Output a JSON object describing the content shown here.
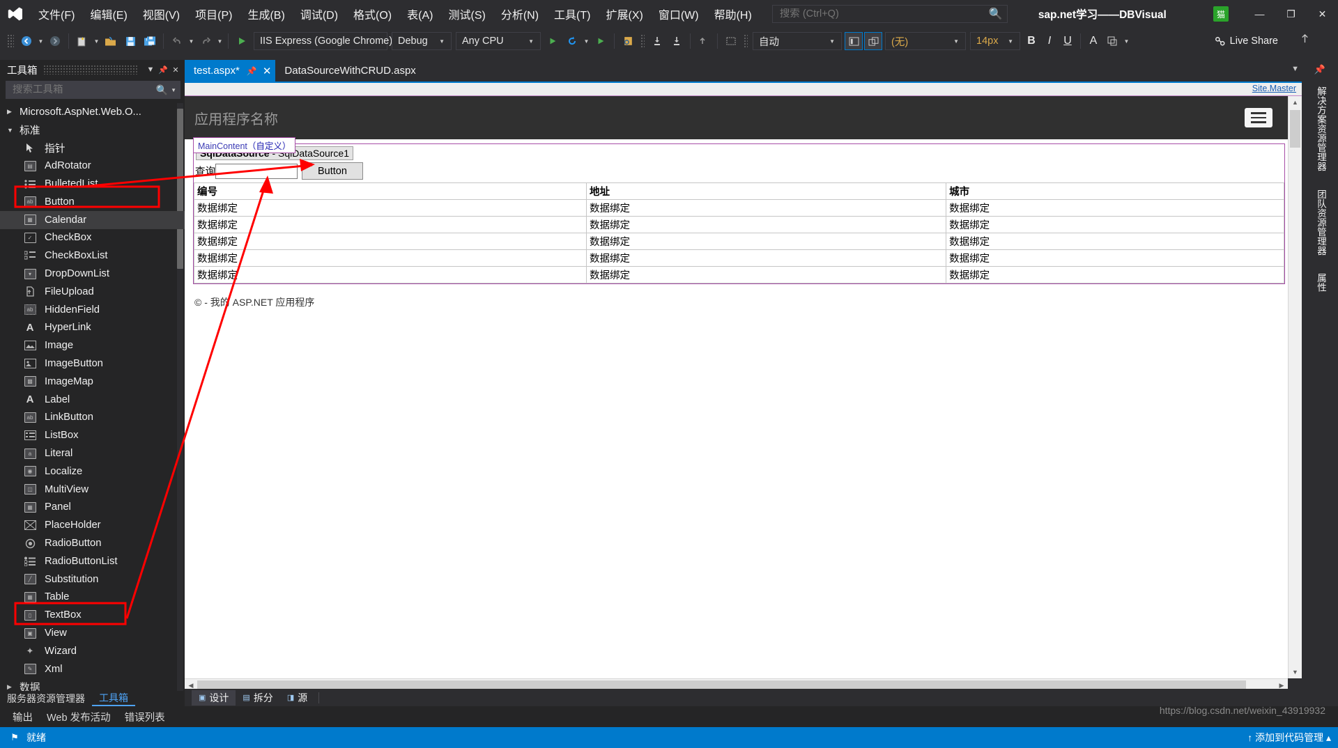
{
  "window": {
    "solution_name": "sap.net学习——DBVisual",
    "notification_count": "猫",
    "minimize": "—",
    "maximize": "❐",
    "close": "✕"
  },
  "menu": {
    "items": [
      {
        "label": "文件(F)"
      },
      {
        "label": "编辑(E)"
      },
      {
        "label": "视图(V)"
      },
      {
        "label": "项目(P)"
      },
      {
        "label": "生成(B)"
      },
      {
        "label": "调试(D)"
      },
      {
        "label": "格式(O)"
      },
      {
        "label": "表(A)"
      },
      {
        "label": "测试(S)"
      },
      {
        "label": "分析(N)"
      },
      {
        "label": "工具(T)"
      },
      {
        "label": "扩展(X)"
      },
      {
        "label": "窗口(W)"
      },
      {
        "label": "帮助(H)"
      }
    ]
  },
  "quick_search": {
    "placeholder": "搜索 (Ctrl+Q)",
    "icon": "search-icon"
  },
  "toolbar": {
    "run_target": "IIS Express (Google Chrome)",
    "configuration": "Debug",
    "platform": "Any CPU",
    "style_apply": "自动",
    "style_class": "(无)",
    "font_size": "14px",
    "bold": "B",
    "italic": "I",
    "underline": "U",
    "font_color": "A",
    "live_share": "Live Share"
  },
  "toolbox": {
    "title": "工具箱",
    "search_placeholder": "搜索工具箱",
    "groups": [
      {
        "label": "Microsoft.AspNet.Web.O...",
        "expanded": false
      },
      {
        "label": "标准",
        "expanded": true
      }
    ],
    "items": [
      {
        "label": "指针",
        "icon": "pointer-icon"
      },
      {
        "label": "AdRotator",
        "icon": "adrotator-icon"
      },
      {
        "label": "BulletedList",
        "icon": "bulletedlist-icon"
      },
      {
        "label": "Button",
        "icon": "button-icon"
      },
      {
        "label": "Calendar",
        "icon": "calendar-icon"
      },
      {
        "label": "CheckBox",
        "icon": "checkbox-icon"
      },
      {
        "label": "CheckBoxList",
        "icon": "checkboxlist-icon"
      },
      {
        "label": "DropDownList",
        "icon": "dropdownlist-icon"
      },
      {
        "label": "FileUpload",
        "icon": "fileupload-icon"
      },
      {
        "label": "HiddenField",
        "icon": "hiddenfield-icon"
      },
      {
        "label": "HyperLink",
        "icon": "hyperlink-icon"
      },
      {
        "label": "Image",
        "icon": "image-icon"
      },
      {
        "label": "ImageButton",
        "icon": "imagebutton-icon"
      },
      {
        "label": "ImageMap",
        "icon": "imagemap-icon"
      },
      {
        "label": "Label",
        "icon": "label-icon"
      },
      {
        "label": "LinkButton",
        "icon": "linkbutton-icon"
      },
      {
        "label": "ListBox",
        "icon": "listbox-icon"
      },
      {
        "label": "Literal",
        "icon": "literal-icon"
      },
      {
        "label": "Localize",
        "icon": "localize-icon"
      },
      {
        "label": "MultiView",
        "icon": "multiview-icon"
      },
      {
        "label": "Panel",
        "icon": "panel-icon"
      },
      {
        "label": "PlaceHolder",
        "icon": "placeholder-icon"
      },
      {
        "label": "RadioButton",
        "icon": "radiobutton-icon"
      },
      {
        "label": "RadioButtonList",
        "icon": "radiobuttonlist-icon"
      },
      {
        "label": "Substitution",
        "icon": "substitution-icon"
      },
      {
        "label": "Table",
        "icon": "table-icon"
      },
      {
        "label": "TextBox",
        "icon": "textbox-icon"
      },
      {
        "label": "View",
        "icon": "view-icon"
      },
      {
        "label": "Wizard",
        "icon": "wizard-icon"
      },
      {
        "label": "Xml",
        "icon": "xml-icon"
      }
    ],
    "next_group": "数据",
    "bottom_tabs": [
      {
        "label": "服务器资源管理器",
        "active": false
      },
      {
        "label": "工具箱",
        "active": true
      }
    ]
  },
  "editor": {
    "tabs": [
      {
        "label": "test.aspx*",
        "active": true,
        "dirty": true
      },
      {
        "label": "DataSourceWithCRUD.aspx",
        "active": false,
        "dirty": false
      }
    ],
    "master_link": "Site.Master",
    "view_tabs": [
      {
        "label": "设计",
        "active": true
      },
      {
        "label": "拆分",
        "active": false
      },
      {
        "label": "源",
        "active": false
      }
    ]
  },
  "design": {
    "app_title": "应用程序名称",
    "region_label_en": "MainContent",
    "region_label_cn": "（自定义）",
    "datasource_type": "SqlDataSource",
    "datasource_sep": " - ",
    "datasource_id": "SqlDataSource1",
    "query_label": "查询",
    "query_value": "",
    "button_label": "Button",
    "grid": {
      "headers": [
        "编号",
        "地址",
        "城市"
      ],
      "rows": [
        [
          "数据绑定",
          "数据绑定",
          "数据绑定"
        ],
        [
          "数据绑定",
          "数据绑定",
          "数据绑定"
        ],
        [
          "数据绑定",
          "数据绑定",
          "数据绑定"
        ],
        [
          "数据绑定",
          "数据绑定",
          "数据绑定"
        ],
        [
          "数据绑定",
          "数据绑定",
          "数据绑定"
        ]
      ]
    },
    "footer": "© - 我的 ASP.NET 应用程序"
  },
  "right_rail": {
    "tabs": [
      "解决方案资源管理器",
      "团队资源管理器",
      "属性"
    ]
  },
  "bottom_panel": {
    "tabs": [
      {
        "label": "输出",
        "active": false
      },
      {
        "label": "Web 发布活动",
        "active": false
      },
      {
        "label": "错误列表",
        "active": false
      }
    ]
  },
  "status": {
    "text": "就绪",
    "icon": "flag-icon"
  },
  "watermarks": {
    "blog": "https://blog.csdn.net/weixin_43919932",
    "bottom": "↑ 添加到代码管理 ▴"
  },
  "colors": {
    "accent": "#007acc",
    "chrome": "#2d2d30",
    "panel": "#252526",
    "annotation": "#ff0000",
    "region_border": "#a64ca6"
  }
}
